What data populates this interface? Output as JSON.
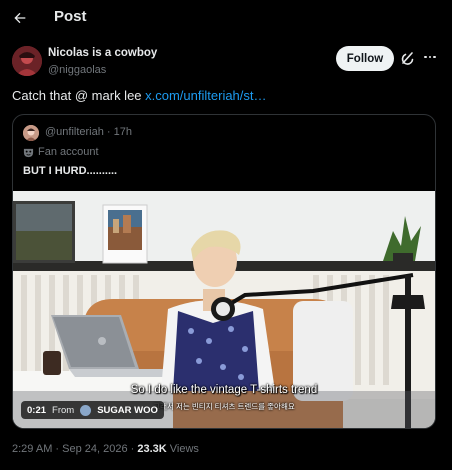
{
  "header": {
    "title": "Post"
  },
  "author": {
    "name": "Nicolas is a cowboy",
    "handle": "@niggaolas",
    "follow_label": "Follow"
  },
  "post": {
    "text": "Catch that @ mark lee ",
    "link": "x.com/unfilteriah/st…"
  },
  "quote": {
    "handle_time": "@unfilteriah · 17h",
    "label": "Fan account",
    "text": "BUT I HURD..........",
    "video": {
      "subtitle_en": "So I do like the vintage T-shirts trend",
      "subtitle_ko": "그래서 저는 빈티지 티셔츠 트렌드를 좋아해요",
      "duration": "0:21",
      "from_label": "From",
      "source": "SUGAR WOO"
    }
  },
  "meta": {
    "time_date": "2:29 AM · Sep 24, 2026 · ",
    "views_count": "23.3K",
    "views_label": " Views"
  },
  "icons": [
    "back-arrow-icon",
    "grok-icon",
    "more-icon",
    "fan-mask-icon"
  ],
  "colors": {
    "link": "#1d9bf0",
    "muted": "#71767b",
    "text": "#e7e9ea",
    "background": "#000000"
  }
}
